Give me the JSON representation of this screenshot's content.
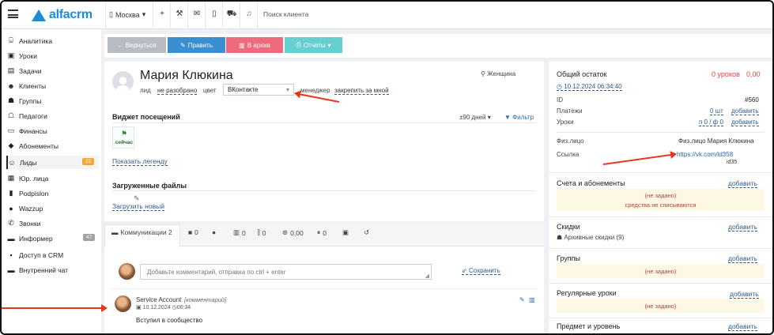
{
  "topbar": {
    "logo_text": "alfacrm",
    "city": "Москва",
    "search_placeholder": "Поиск клиента",
    "icons": [
      "plus-icon",
      "wrench-icon",
      "mail-icon",
      "phone-icon",
      "cart-icon",
      "bell-icon"
    ]
  },
  "sidebar": {
    "items": [
      {
        "label": "Аналитика",
        "icon": "analytics-icon"
      },
      {
        "label": "Уроки",
        "icon": "calendar-icon"
      },
      {
        "label": "Задачи",
        "icon": "tasks-icon"
      },
      {
        "label": "Клиенты",
        "icon": "clients-icon"
      },
      {
        "label": "Группы",
        "icon": "groups-icon"
      },
      {
        "label": "Педагоги",
        "icon": "teachers-icon"
      },
      {
        "label": "Финансы",
        "icon": "finance-icon"
      },
      {
        "label": "Абонементы",
        "icon": "tag-icon"
      },
      {
        "label": "Лиды",
        "icon": "leads-icon",
        "badge": "22",
        "active": true
      },
      {
        "label": "Юр. лица",
        "icon": "legal-icon"
      },
      {
        "label": "Podpislon",
        "icon": "document-icon"
      },
      {
        "label": "Wazzup",
        "icon": "whatsapp-icon"
      },
      {
        "label": "Звонки",
        "icon": "phone-icon"
      },
      {
        "label": "Информер",
        "icon": "informer-icon",
        "badge": "47"
      },
      {
        "label": "Доступ в CRM",
        "icon": "lock-icon"
      },
      {
        "label": "Внутренний чат",
        "icon": "chat-icon"
      }
    ]
  },
  "actions": {
    "back": "← Вернуться",
    "edit": "Править",
    "archive": "В архив",
    "reports": "Отчеты"
  },
  "client": {
    "name": "Мария Клюкина",
    "gender": "Женщина",
    "status_label": "лид",
    "status_value": "не разобрано",
    "color_label": "цвет",
    "source_value": "ВКонтакте",
    "manager_label": "менеджер",
    "manager_action": "закрепить за мной"
  },
  "visits": {
    "title": "Виджет посещений",
    "period": "±90 дней",
    "filter": "Фильтр",
    "today_label": "сейчас",
    "legend_link": "Показать легенду"
  },
  "files": {
    "title": "Загруженные файлы",
    "upload_link": "Загрузить новый"
  },
  "tabs": [
    {
      "label": "Коммуникации 2",
      "icon": "comments-icon"
    },
    {
      "label": "0",
      "icon": "message-icon"
    },
    {
      "label": "",
      "icon": "whatsapp-icon"
    },
    {
      "label": "0",
      "icon": "document-icon"
    },
    {
      "label": "0",
      "icon": "stats-icon"
    },
    {
      "label": "0,00",
      "icon": "wallet-icon"
    },
    {
      "label": "0",
      "icon": "pause-icon"
    },
    {
      "label": "",
      "icon": "camera-icon"
    },
    {
      "label": "",
      "icon": "history-icon"
    }
  ],
  "comments": {
    "placeholder": "Добавьте комментарий, отправка по ctrl + enter",
    "save": "Сохранить",
    "entry": {
      "author": "Service Account",
      "type": "[комментарий]",
      "date": "10.12.2024",
      "time": "06:34",
      "text": "Вступил в сообщество"
    }
  },
  "balance": {
    "title": "Общий остаток",
    "lessons": "0 уроков",
    "amount": "0,00",
    "date_link": "10.12.2024 06:34:40",
    "id_label": "ID",
    "id_value": "#560",
    "payments_label": "Платежи",
    "payments_value": "0 шт",
    "lessons_label": "Уроки",
    "lessons_value": "п 0 / ф 0",
    "add": "добавить",
    "person_label": "Физ.лицо",
    "person_value": "Физ.лицо Мария Клюкина",
    "link_label": "Ссылка",
    "link_value": "https://vk.com/id358",
    "link_sub": "id35"
  },
  "sections": {
    "accounts": {
      "title": "Счета и абонементы",
      "empty": "(не задано)",
      "note": "средства не списываются"
    },
    "discounts": {
      "title": "Скидки",
      "item": "Архивные скидки (9)"
    },
    "groups": {
      "title": "Группы",
      "empty": "(не задано)"
    },
    "regular": {
      "title": "Регулярные уроки",
      "empty": "(не задано)"
    },
    "subjects": {
      "title": "Предмет и уровень"
    }
  },
  "colors": {
    "accent": "#1a8cd8",
    "back_btn": "#b8bcc2",
    "edit_btn": "#3a8fd0",
    "archive_btn": "#ee6b7d",
    "reports_btn": "#67cfd0",
    "badge_orange": "#f0a73b",
    "badge_gray": "#9ea3a8",
    "annotation_arrow": "#e8351e"
  }
}
